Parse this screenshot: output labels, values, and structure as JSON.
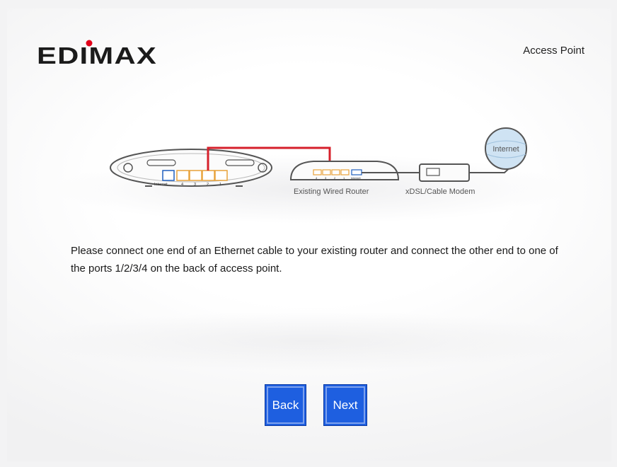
{
  "brand": {
    "name": "EDIMAX",
    "accent": "#e2001a"
  },
  "header": {
    "product": "Access Point"
  },
  "diagram": {
    "ap_labels": [
      "Internet",
      "4",
      "3",
      "2",
      "1"
    ],
    "router_labels": [
      "4",
      "3",
      "2",
      "1",
      "Internet"
    ],
    "router_caption": "Existing Wired Router",
    "modem_caption": "xDSL/Cable Modem",
    "cloud_label": "Internet",
    "cable_color": "#d6202b"
  },
  "instruction": {
    "text": "Please connect one end of an Ethernet cable to your existing router and connect the other end to one of the ports 1/2/3/4 on the back of access point."
  },
  "buttons": {
    "back": "Back",
    "next": "Next",
    "color": "#1e5fe0"
  }
}
